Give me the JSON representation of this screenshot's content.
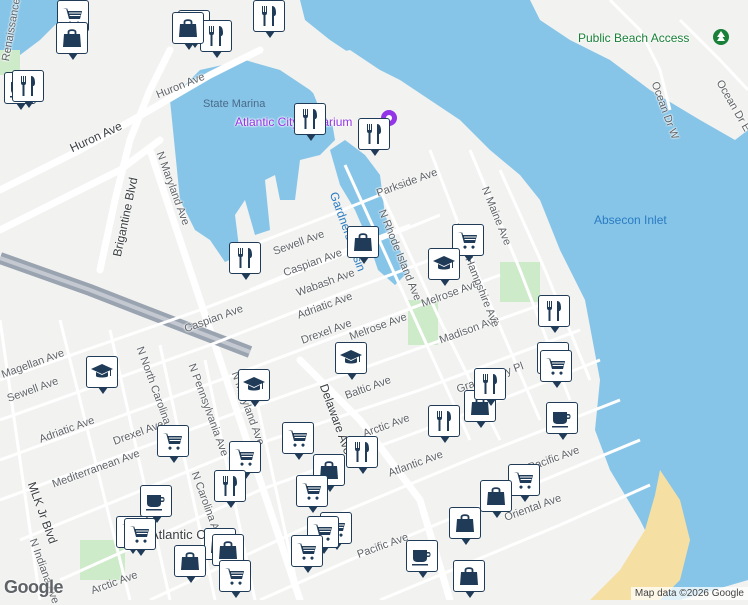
{
  "map": {
    "attribution": "Map data ©2026 Google",
    "logo": "Google",
    "colors": {
      "water": "#86c5e8",
      "land": "#f2f2f0",
      "park": "#cdeac9",
      "beach": "#f6dfa3",
      "road": "#ffffff",
      "highway": "#9aa3b0",
      "marker_border": "#1f3b57"
    },
    "labels": {
      "public_beach_access": "Public Beach Access",
      "absecon_inlet": "Absecon Inlet",
      "state_marina": "State Marina",
      "atlantic_aquarium": "Atlantic City Aquarium",
      "gardners_basin": "Gardners Basin",
      "huron_ave_1": "Huron Ave",
      "huron_ave_2": "Huron Ave",
      "renaissance_point": "Renaissance Point",
      "brigantine_blvd": "Brigantine Blvd",
      "n_maryland_ave_1": "N Maryland Ave",
      "n_maryland_ave_2": "N Maryland Ave",
      "sewell_ave_1": "Sewell Ave",
      "sewell_ave_2": "Sewell Ave",
      "caspian_ave_1": "Caspian Ave",
      "caspian_ave_2": "Caspian Ave",
      "wabash_ave": "Wabash Ave",
      "adriatic_ave_1": "Adriatic Ave",
      "adriatic_ave_2": "Adriatic Ave",
      "drexel_ave_1": "Drexel Ave",
      "drexel_ave_2": "Drexel Ave",
      "melrose_ave_1": "Melrose Ave",
      "melrose_ave_2": "Melrose Ave",
      "madison_ave": "Madison Ave",
      "parkside_ave": "Parkside Ave",
      "n_rhode_island_ave": "N Rhode Island Ave",
      "n_maine_ave": "N Maine Ave",
      "new_hampshire_ave": "N New Hampshire Ave",
      "grammercy_pl": "Grammercy Pl",
      "baltic_ave": "Baltic Ave",
      "arctic_ave_1": "Arctic Ave",
      "arctic_ave_2": "Arctic Ave",
      "atlantic_ave": "Atlantic Ave",
      "pacific_ave_1": "Pacific Ave",
      "pacific_ave_2": "Pacific Ave",
      "oriental_ave": "Oriental Ave",
      "magellan_ave": "Magellan Ave",
      "mediterranean_ave": "Mediterranean Ave",
      "n_north_carolina_ave": "N North Carolina Ave",
      "n_pennsylvania_ave": "N Pennsylvania Ave",
      "n_carolina_ave": "N Carolina Ave",
      "delaware_ave": "Delaware Ave",
      "mlk_jr_blvd": "MLK Jr Blvd",
      "n_indiana_ave": "N Indiana Ave",
      "atlantic_city": "Atlantic City",
      "ocean_dr_w": "Ocean Dr W",
      "ocean_dr_e": "Ocean Dr E"
    },
    "markers": [
      {
        "id": "m1",
        "icon": "shopping-cart-icon"
      },
      {
        "id": "m2",
        "icon": "restaurant-icon"
      },
      {
        "id": "m3",
        "icon": "shopping-bag-icon"
      },
      {
        "id": "m4",
        "icon": "restaurant-icon"
      },
      {
        "id": "m5",
        "icon": "restaurant-icon"
      },
      {
        "id": "m6",
        "icon": "shopping-bag-icon"
      },
      {
        "id": "m7",
        "icon": "coffee-icon"
      },
      {
        "id": "m8",
        "icon": "restaurant-icon"
      },
      {
        "id": "m9",
        "icon": "restaurant-icon"
      },
      {
        "id": "m10",
        "icon": "restaurant-icon"
      },
      {
        "id": "m11",
        "icon": "shopping-bag-icon"
      },
      {
        "id": "m12",
        "icon": "shopping-cart-icon"
      },
      {
        "id": "m13",
        "icon": "school-icon"
      },
      {
        "id": "m14",
        "icon": "restaurant-icon"
      },
      {
        "id": "m15",
        "icon": "shopping-cart-icon"
      },
      {
        "id": "m16",
        "icon": "school-icon"
      },
      {
        "id": "m17",
        "icon": "school-icon"
      },
      {
        "id": "m18",
        "icon": "school-icon"
      },
      {
        "id": "m19",
        "icon": "restaurant-icon"
      },
      {
        "id": "m20",
        "icon": "shopping-bag-icon"
      },
      {
        "id": "m21",
        "icon": "restaurant-icon"
      },
      {
        "id": "m22",
        "icon": "restaurant-icon"
      },
      {
        "id": "m23",
        "icon": "coffee-icon"
      },
      {
        "id": "m24",
        "icon": "shopping-cart-icon"
      },
      {
        "id": "m25",
        "icon": "shopping-cart-icon"
      },
      {
        "id": "m26",
        "icon": "shopping-cart-icon"
      },
      {
        "id": "m27",
        "icon": "shopping-bag-icon"
      },
      {
        "id": "m28",
        "icon": "restaurant-icon"
      },
      {
        "id": "m29",
        "icon": "coffee-icon"
      },
      {
        "id": "m30",
        "icon": "restaurant-icon"
      },
      {
        "id": "m31",
        "icon": "shopping-cart-icon"
      },
      {
        "id": "m32",
        "icon": "shopping-cart-icon"
      },
      {
        "id": "m33",
        "icon": "shopping-cart-icon"
      },
      {
        "id": "m34",
        "icon": "shopping-bag-icon"
      },
      {
        "id": "m35",
        "icon": "shopping-cart-icon"
      },
      {
        "id": "m36",
        "icon": "shopping-cart-icon"
      },
      {
        "id": "m37",
        "icon": "shopping-cart-icon"
      },
      {
        "id": "m38",
        "icon": "shopping-bag-icon"
      },
      {
        "id": "m39",
        "icon": "shopping-bag-icon"
      },
      {
        "id": "m40",
        "icon": "coffee-icon"
      },
      {
        "id": "m41",
        "icon": "shopping-cart-icon"
      },
      {
        "id": "m42",
        "icon": "shopping-bag-icon"
      },
      {
        "id": "m43",
        "icon": "coffee-icon"
      },
      {
        "id": "m44",
        "icon": "shopping-cart-icon"
      },
      {
        "id": "m45",
        "icon": "shopping-bag-icon"
      },
      {
        "id": "m46",
        "icon": "shopping-bag-icon"
      },
      {
        "id": "m47",
        "icon": "shopping-cart-icon"
      }
    ]
  }
}
